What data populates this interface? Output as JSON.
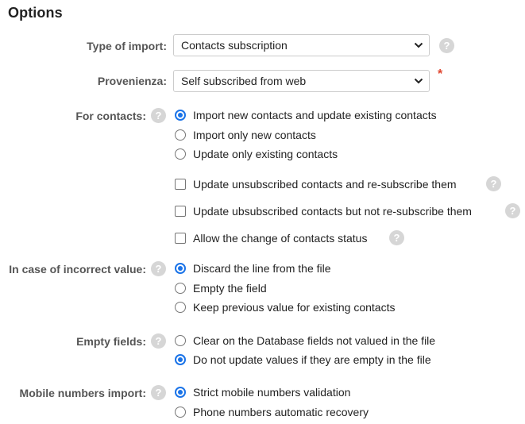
{
  "title": "Options",
  "type_of_import": {
    "label": "Type of import:",
    "value": "Contacts subscription"
  },
  "provenienza": {
    "label": "Provenienza:",
    "value": "Self subscribed from web",
    "required_mark": "*"
  },
  "help_icon": "?",
  "for_contacts": {
    "label": "For contacts:",
    "options": [
      {
        "label": "Import new contacts and update existing contacts",
        "selected": true
      },
      {
        "label": "Import only new contacts",
        "selected": false
      },
      {
        "label": "Update only existing contacts",
        "selected": false
      }
    ],
    "checkboxes": [
      {
        "label": "Update unsubscribed contacts and re-subscribe them",
        "checked": false
      },
      {
        "label": "Update ubsubscribed contacts but not re-subscribe them",
        "checked": false
      },
      {
        "label": "Allow the change of contacts status",
        "checked": false
      }
    ]
  },
  "incorrect_value": {
    "label": "In case of incorrect value:",
    "options": [
      {
        "label": "Discard the line from the file",
        "selected": true
      },
      {
        "label": "Empty the field",
        "selected": false
      },
      {
        "label": "Keep previous value for existing contacts",
        "selected": false
      }
    ]
  },
  "empty_fields": {
    "label": "Empty fields:",
    "options": [
      {
        "label": "Clear on the Database fields not valued in the file",
        "selected": false
      },
      {
        "label": "Do not update values if they are empty in the file",
        "selected": true
      }
    ]
  },
  "mobile_numbers": {
    "label": "Mobile numbers import:",
    "options": [
      {
        "label": "Strict mobile numbers validation",
        "selected": true
      },
      {
        "label": "Phone numbers automatic recovery",
        "selected": false
      }
    ]
  },
  "colors": {
    "accent": "#1a73e8",
    "required": "#e0452e",
    "help_bg": "#d6d6d6"
  }
}
